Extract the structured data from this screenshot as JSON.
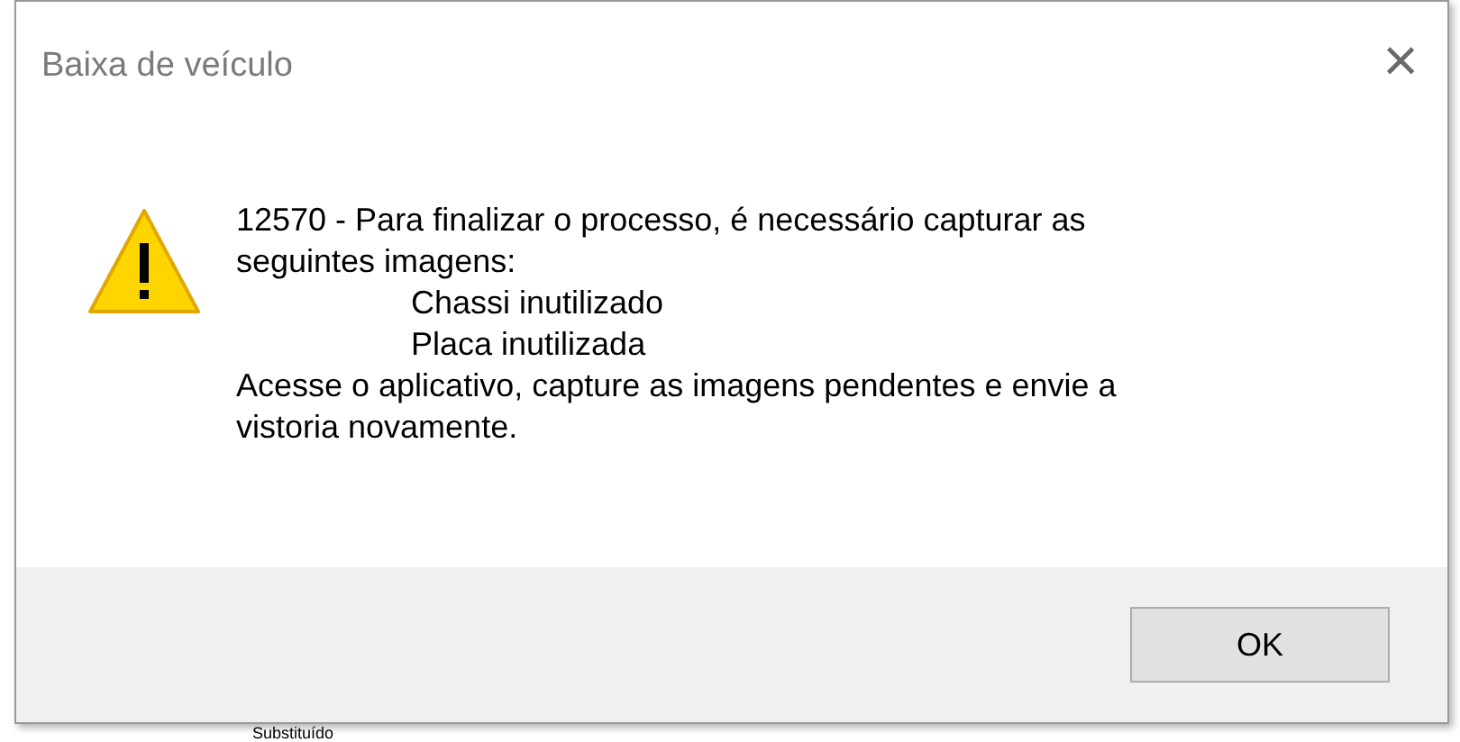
{
  "dialog": {
    "title": "Baixa de veículo",
    "close": "×",
    "message": {
      "lines": [
        {
          "text": "12570 - Para finalizar o processo, é necessário capturar as",
          "indented": false
        },
        {
          "text": "seguintes imagens:",
          "indented": false
        },
        {
          "text": "Chassi inutilizado",
          "indented": true
        },
        {
          "text": "Placa inutilizada",
          "indented": true
        },
        {
          "text": "Acesse o aplicativo, capture as imagens pendentes e envie a",
          "indented": false
        },
        {
          "text": "vistoria novamente.",
          "indented": false
        }
      ]
    },
    "buttons": [
      "OK"
    ]
  },
  "background": {
    "label": "Substituído"
  }
}
